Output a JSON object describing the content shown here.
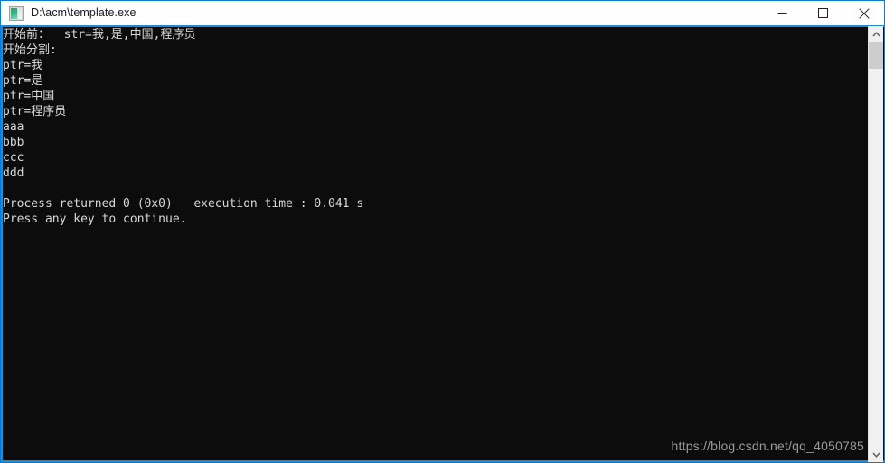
{
  "window": {
    "title": "D:\\acm\\template.exe",
    "icon": "console-app-icon",
    "controls": {
      "minimize_label": "–",
      "maximize_label": "☐",
      "close_label": "✕"
    },
    "accent_color": "#1f8bd4",
    "titlebar_bg": "#ffffff"
  },
  "console": {
    "background_color": "#0c0c0c",
    "text_color": "#d8d8d8",
    "lines": [
      "开始前：  str=我,是,中国,程序员",
      "开始分割:",
      "ptr=我",
      "ptr=是",
      "ptr=中国",
      "ptr=程序员",
      "aaa",
      "bbb",
      "ccc",
      "ddd",
      "",
      "Process returned 0 (0x0)   execution time : 0.041 s",
      "Press any key to continue."
    ]
  },
  "watermark": {
    "text": "https://blog.csdn.net/qq_4050785"
  },
  "scrollbar": {
    "up_arrow": "chevron-up-icon",
    "down_arrow": "chevron-down-icon",
    "thumb_position_pct": 4
  }
}
